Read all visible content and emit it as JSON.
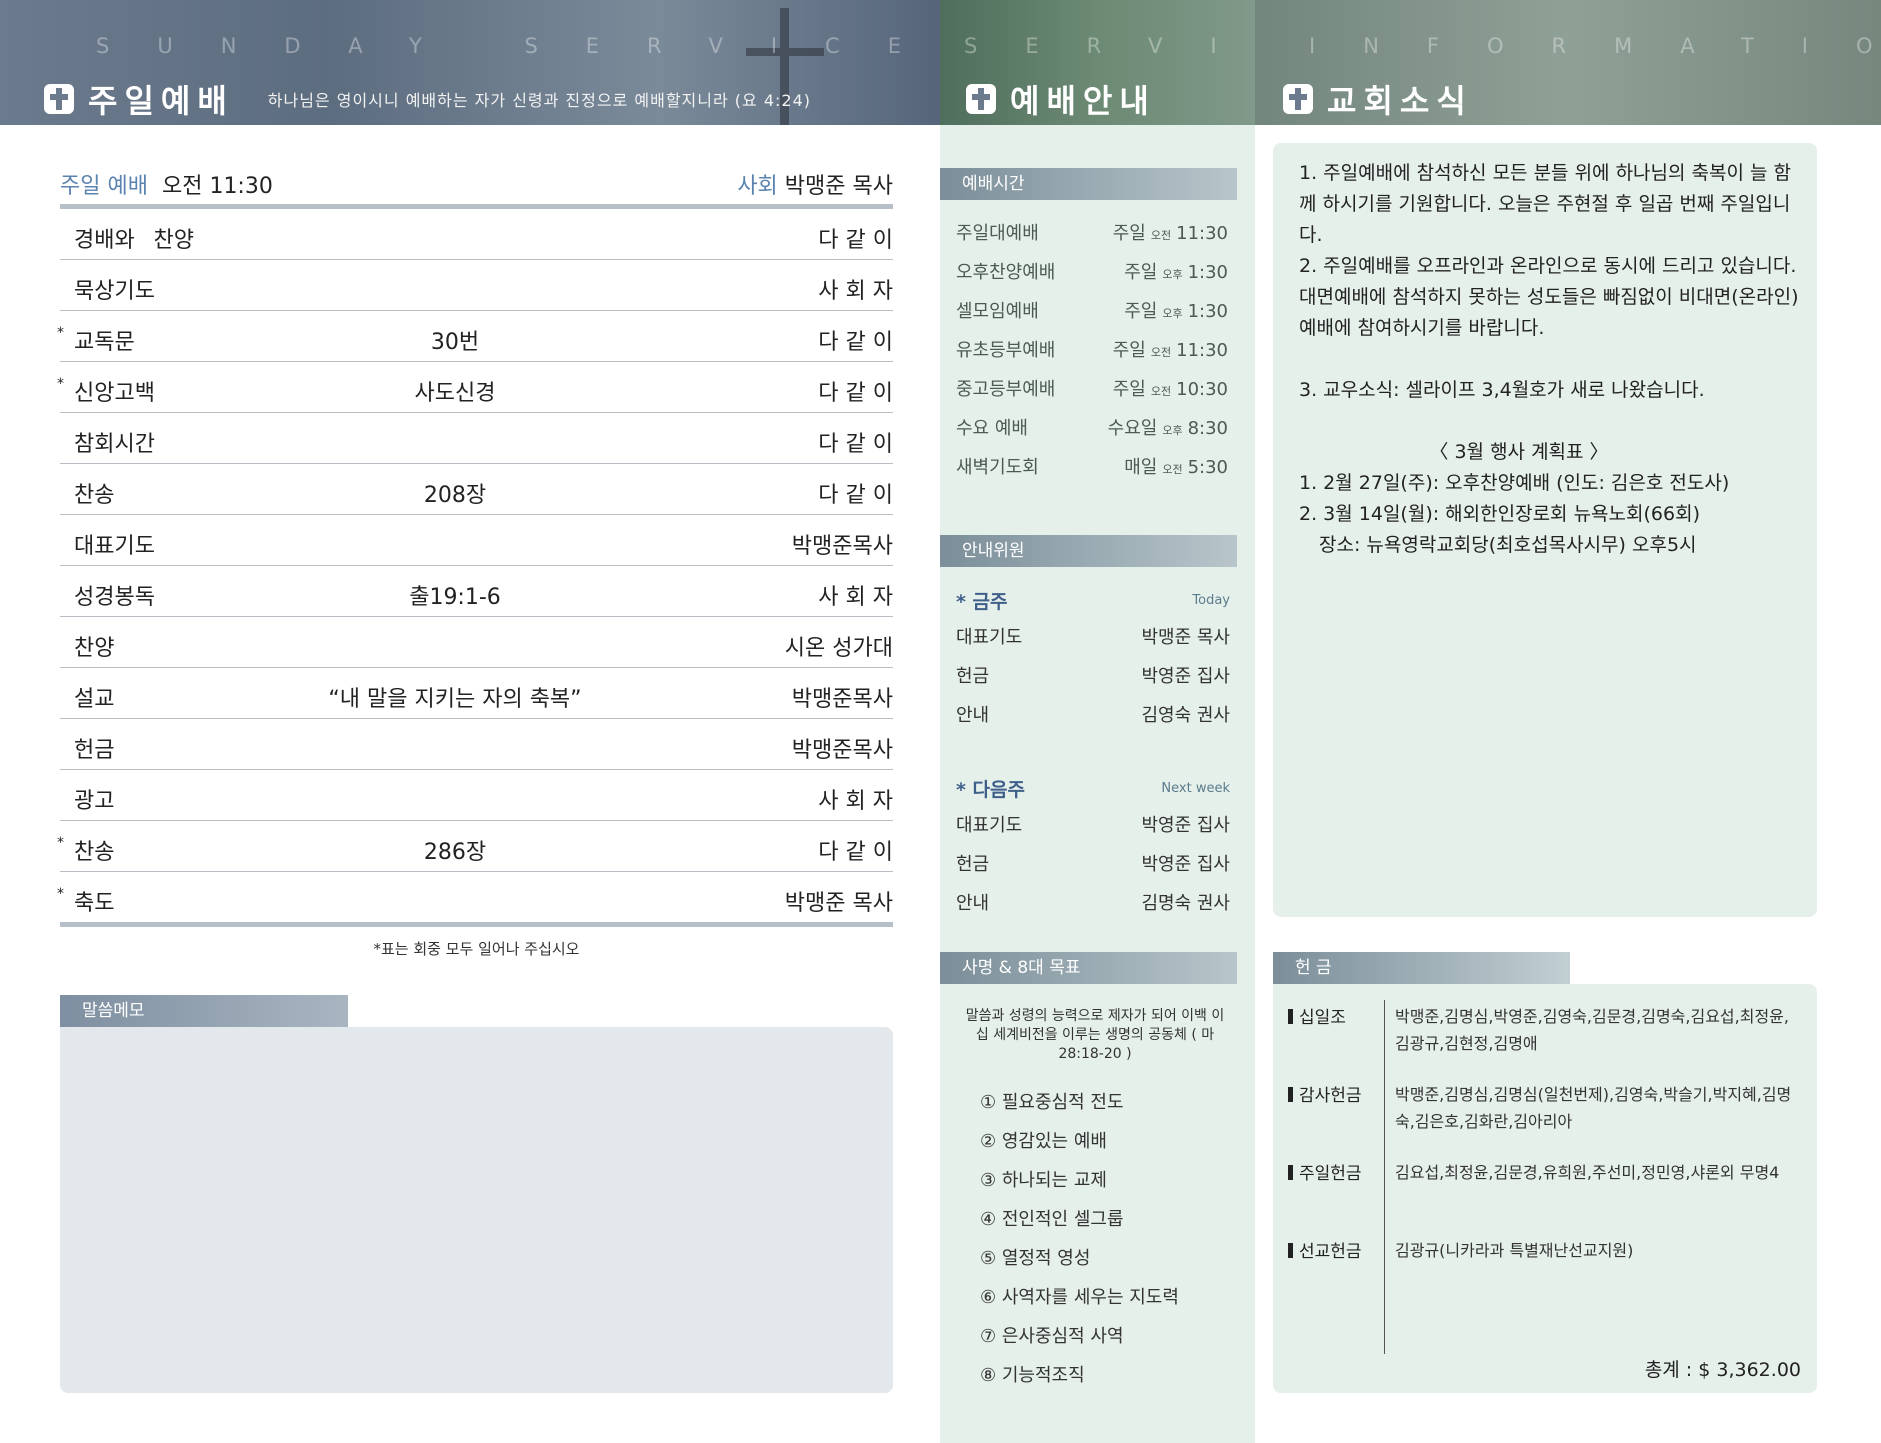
{
  "header": {
    "sunday": {
      "eng": "SUNDAY SERVICE",
      "title": "주일예배",
      "verse": "하나님은 영이시니 예배하는 자가 신령과 진정으로 예배할지니라 (요 4:24)"
    },
    "service": {
      "eng": "SERVICE",
      "title": "예배안내"
    },
    "info": {
      "eng": "INFORMATION",
      "title": "교회소식"
    }
  },
  "worship": {
    "label": "주일 예배",
    "time": "오전 11:30",
    "leader_label": "사회",
    "leader": "박맹준 목사",
    "order": [
      {
        "star": "",
        "name": "경배와 찬양",
        "mid": "",
        "right": "다 같 이"
      },
      {
        "star": "",
        "name": "묵상기도",
        "mid": "",
        "right": "사 회 자"
      },
      {
        "star": "*",
        "name": "교독문",
        "mid": "30번",
        "right": "다 같 이"
      },
      {
        "star": "*",
        "name": "신앙고백",
        "mid": "사도신경",
        "right": "다 같 이"
      },
      {
        "star": "",
        "name": "참회시간",
        "mid": "",
        "right": "다 같 이"
      },
      {
        "star": "",
        "name": "찬송",
        "mid": "208장",
        "right": "다 같 이"
      },
      {
        "star": "",
        "name": "대표기도",
        "mid": "",
        "right": "박맹준목사"
      },
      {
        "star": "",
        "name": "성경봉독",
        "mid": "출19:1-6",
        "right": "사 회 자"
      },
      {
        "star": "",
        "name": "찬양",
        "mid": "",
        "right": "시온 성가대"
      },
      {
        "star": "",
        "name": "설교",
        "mid": "“내 말을 지키는 자의 축복”",
        "right": "박맹준목사"
      },
      {
        "star": "",
        "name": "헌금",
        "mid": "",
        "right": "박맹준목사"
      },
      {
        "star": "",
        "name": "광고",
        "mid": "",
        "right": "사 회 자"
      },
      {
        "star": "*",
        "name": "찬송",
        "mid": "286장",
        "right": "다 같 이"
      },
      {
        "star": "*",
        "name": "축도",
        "mid": "",
        "right": "박맹준 목사"
      }
    ],
    "note": "*표는 회중 모두 일어나 주십시오"
  },
  "memo": {
    "label": "말씀메모"
  },
  "schedule": {
    "label": "예배시간",
    "rows": [
      {
        "name": "주일대예배",
        "day": "주일",
        "ampm": "오전",
        "time": "11:30"
      },
      {
        "name": "오후찬양예배",
        "day": "주일",
        "ampm": "오후",
        "time": "1:30"
      },
      {
        "name": "셀모임예배",
        "day": "주일",
        "ampm": "오후",
        "time": "1:30"
      },
      {
        "name": "유초등부예배",
        "day": "주일",
        "ampm": "오전",
        "time": "11:30"
      },
      {
        "name": "중고등부예배",
        "day": "주일",
        "ampm": "오전",
        "time": "10:30"
      },
      {
        "name": "수요 예배",
        "day": "수요일",
        "ampm": "오후",
        "time": "8:30"
      },
      {
        "name": "새벽기도회",
        "day": "매일",
        "ampm": "오전",
        "time": "5:30"
      }
    ]
  },
  "ushers": {
    "label": "안내위원",
    "this_week": {
      "title": "* 금주",
      "eng": "Today",
      "rows": [
        {
          "role": "대표기도",
          "name": "박맹준 목사"
        },
        {
          "role": "헌금",
          "name": "박영준 집사"
        },
        {
          "role": "안내",
          "name": "김영숙 권사"
        }
      ]
    },
    "next_week": {
      "title": "* 다음주",
      "eng": "Next week",
      "rows": [
        {
          "role": "대표기도",
          "name": "박영준 집사"
        },
        {
          "role": "헌금",
          "name": "박영준 집사"
        },
        {
          "role": "안내",
          "name": "김명숙 권사"
        }
      ]
    }
  },
  "mission": {
    "label": "사명 & 8대 목표",
    "statement": "말씀과 성령의 능력으로 제자가 되어 이백 이십 세계비전을 이루는 생명의 공동체 ( 마 28:18-20 )",
    "goals": [
      "① 필요중심적 전도",
      "② 영감있는 예배",
      "③ 하나되는 교제",
      "④ 전인적인 셀그룹",
      "⑤ 열정적 영성",
      "⑥ 사역자를 세우는 지도력",
      "⑦ 은사중심적 사역",
      "⑧ 기능적조직"
    ]
  },
  "news": {
    "p1": "1. 주일예배에 참석하신 모든 분들 위에 하나님의 축복이 늘 함께 하시기를 기원합니다. 오늘은 주현절 후 일곱 번째 주일입니다.",
    "p2": "2. 주일예배를 오프라인과 온라인으로 동시에 드리고 있습니다. 대면예배에 참석하지 못하는 성도들은 빠짐없이 비대면(온라인)예배에 참여하시기를 바랍니다.",
    "p3": "3. 교우소식: 셀라이프 3,4월호가 새로 나왔습니다.",
    "plan_title": "〈   3월 행사 계획표   〉",
    "plan1": "1. 2월 27일(주): 오후찬양예배 (인도: 김은호 전도사)",
    "plan2": "2. 3월 14일(월): 해외한인장로회 뉴욕노회(66회)",
    "plan3": "장소: 뉴욕영락교회당(최호섭목사시무) 오후5시"
  },
  "offering": {
    "label": "헌 금",
    "groups": [
      {
        "name": "십일조",
        "donors": "박맹준,김명심,박영준,김영숙,김문경,김명숙,김요섭,최정윤,김광규,김현정,김명애"
      },
      {
        "name": "감사헌금",
        "donors": "박맹준,김명심,김명심(일천번제),김영숙,박슬기,박지혜,김명숙,김은호,김화란,김아리아"
      },
      {
        "name": "주일헌금",
        "donors": "김요섭,최정윤,김문경,유희원,주선미,정민영,샤론외  무명4"
      },
      {
        "name": "선교헌금",
        "donors": "김광규(니카라과 특별재난선교지원)"
      }
    ],
    "total": "총계 : $ 3,362.00"
  }
}
